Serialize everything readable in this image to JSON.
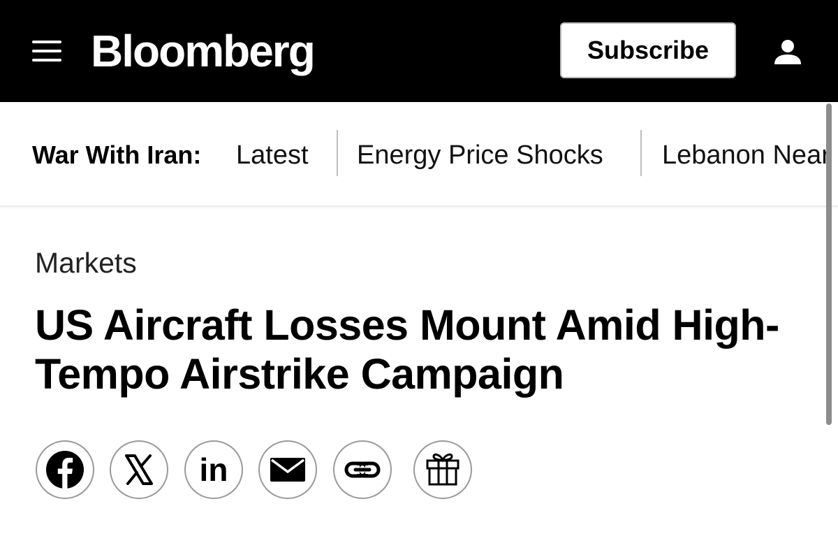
{
  "topbar": {
    "logo": "Bloomberg",
    "subscribe_label": "Subscribe",
    "menu_icon": "hamburger-menu-icon",
    "account_icon": "user-account-icon",
    "background": "#000000"
  },
  "nav": {
    "label": "War With Iran:",
    "links": [
      {
        "label": "Latest"
      },
      {
        "label": "Energy Price Shocks"
      },
      {
        "label": "Lebanon Near"
      }
    ]
  },
  "article": {
    "section": "Markets",
    "headline": "US Aircraft Losses Mount Amid High-Tempo Airstrike Campaign"
  },
  "share": {
    "buttons": [
      {
        "icon": "facebook-icon"
      },
      {
        "icon": "x-icon"
      },
      {
        "icon": "linkedin-icon",
        "text": "in"
      },
      {
        "icon": "email-icon"
      },
      {
        "icon": "copy-link-icon"
      },
      {
        "icon": "gift-icon"
      }
    ]
  }
}
